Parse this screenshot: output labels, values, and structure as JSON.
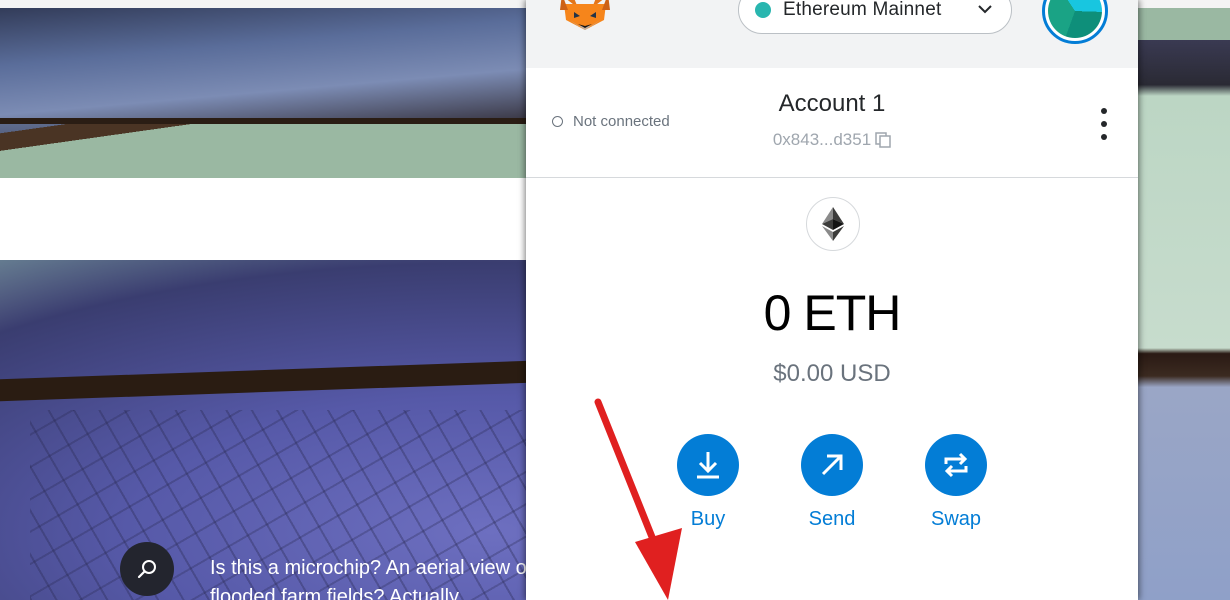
{
  "background_page": {
    "caption": "Is this a microchip? An aerial view of flooded farm fields? Actually, it's",
    "caption_line2": "flooded farm fields? Actually,",
    "search_icon": "search-icon"
  },
  "header": {
    "logo_icon": "metamask-fox-icon",
    "network": {
      "label": "Ethereum Mainnet",
      "dot_color": "#29b6af",
      "chevron_icon": "chevron-down-icon"
    },
    "avatar_icon": "account-identicon"
  },
  "account": {
    "connection_status": "Not connected",
    "name": "Account 1",
    "address": "0x843...d351",
    "copy_icon": "copy-icon",
    "menu_icon": "kebab-menu-icon"
  },
  "balance": {
    "token_icon": "ethereum-icon",
    "amount": "0 ETH",
    "fiat": "$0.00 USD"
  },
  "actions": [
    {
      "label": "Buy",
      "icon": "download-icon"
    },
    {
      "label": "Send",
      "icon": "arrow-up-right-icon"
    },
    {
      "label": "Swap",
      "icon": "swap-icon"
    }
  ],
  "annotation": {
    "icon": "red-arrow-icon",
    "color": "#e02020"
  },
  "colors": {
    "accent": "#037dd6",
    "header_bg": "#f2f3f4"
  }
}
